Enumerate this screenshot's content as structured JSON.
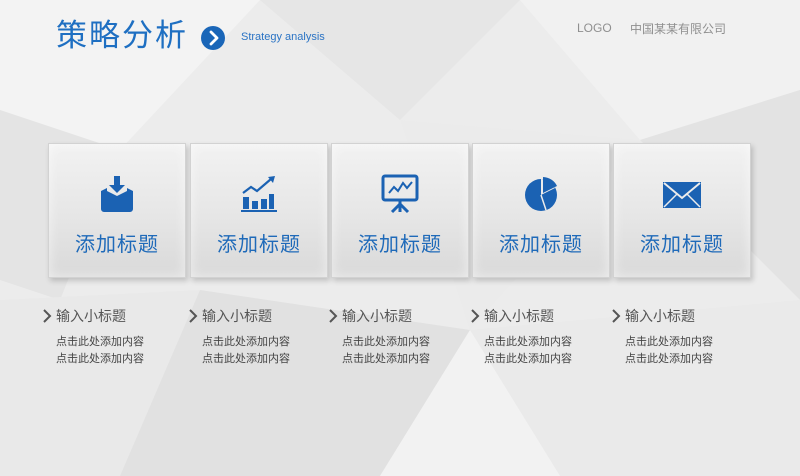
{
  "header": {
    "title": "策略分析",
    "subtitle": "Strategy analysis",
    "logo": "LOGO",
    "company": "中国某某有限公司"
  },
  "colors": {
    "accent": "#1e6fc2",
    "button": "#1a66b8",
    "text_muted": "#8f8f8f"
  },
  "cards": [
    {
      "icon": "download-box-icon",
      "title": "添加标题"
    },
    {
      "icon": "bar-chart-growth-icon",
      "title": "添加标题"
    },
    {
      "icon": "presentation-board-icon",
      "title": "添加标题"
    },
    {
      "icon": "pie-chart-icon",
      "title": "添加标题"
    },
    {
      "icon": "envelope-icon",
      "title": "添加标题"
    }
  ],
  "items": [
    {
      "subtitle": "输入小标题",
      "line1": "点击此处添加内容",
      "line2": "点击此处添加内容"
    },
    {
      "subtitle": "输入小标题",
      "line1": "点击此处添加内容",
      "line2": "点击此处添加内容"
    },
    {
      "subtitle": "输入小标题",
      "line1": "点击此处添加内容",
      "line2": "点击此处添加内容"
    },
    {
      "subtitle": "输入小标题",
      "line1": "点击此处添加内容",
      "line2": "点击此处添加内容"
    },
    {
      "subtitle": "输入小标题",
      "line1": "点击此处添加内容",
      "line2": "点击此处添加内容"
    }
  ]
}
